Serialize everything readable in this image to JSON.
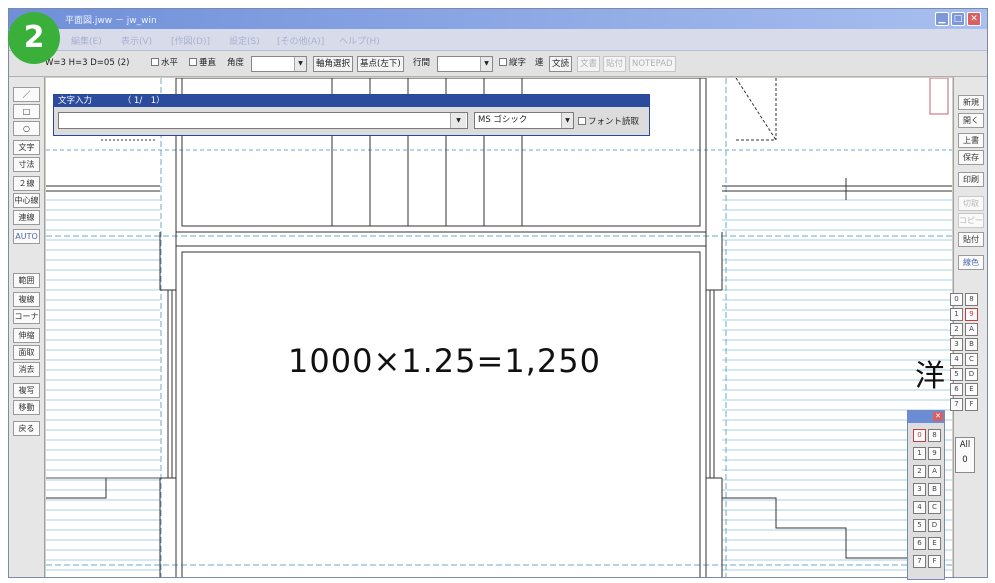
{
  "badge": {
    "number": "2"
  },
  "window": {
    "title": "平面図.jww － jw_win"
  },
  "menu": {
    "items": [
      "編集(E)",
      "表示(V)",
      "[作図(D)]",
      "設定(S)",
      "[その他(A)]",
      "ヘルプ(H)"
    ]
  },
  "toolbar": {
    "dims": "W=3 H=3 D=05 (2)",
    "horizontal": "水平",
    "vertical": "垂直",
    "angle_label": "角度",
    "angle_value": "",
    "extract": "軸角選択",
    "base_point": "基点(左下)",
    "pitch_label": "行間",
    "pitch_value": "",
    "vertical_write": "縦字",
    "vertical_write_short": "連",
    "char_button": "文読",
    "dim_buttons": [
      "文書",
      "貼付",
      "NOTEPAD"
    ]
  },
  "left_tools": [
    "／",
    "□",
    "○",
    "文字",
    "寸法",
    "２線",
    "中心線",
    "連線",
    "AUTO",
    "範囲",
    "複線",
    "コーナー",
    "伸縮",
    "面取",
    "消去",
    "複写",
    "移動",
    "戻る"
  ],
  "right_tools": {
    "buttons": [
      "新規",
      "開く",
      "上書",
      "保存",
      "印刷"
    ],
    "dim_buttons": [
      "切取",
      "コピー"
    ],
    "paste": "貼付",
    "extra": "線色"
  },
  "dialog": {
    "title": "文字入力",
    "counter": "（ 1/　1）",
    "text_value": "",
    "font": "MS ゴシック",
    "font_read_label": "フォント読取"
  },
  "drawing": {
    "formula": "1000×1.25=1,250",
    "partial_label": "洋"
  },
  "layers": {
    "left": [
      "0",
      "1",
      "2",
      "3",
      "4",
      "5",
      "6",
      "7"
    ],
    "right": [
      "8",
      "9",
      "A",
      "B",
      "C",
      "D",
      "E",
      "F"
    ],
    "active": "0",
    "all_label": "All",
    "all_value": "0"
  },
  "layer_groups": {
    "left": [
      "0",
      "1",
      "2",
      "3",
      "4",
      "5",
      "6",
      "7"
    ],
    "right": [
      "8",
      "9",
      "A",
      "B",
      "C",
      "D",
      "E",
      "F"
    ]
  },
  "colors": {
    "accent_title": "#2b4c9c",
    "badge_green": "#3ab03a",
    "guide_blue": "#7fb6d8"
  }
}
